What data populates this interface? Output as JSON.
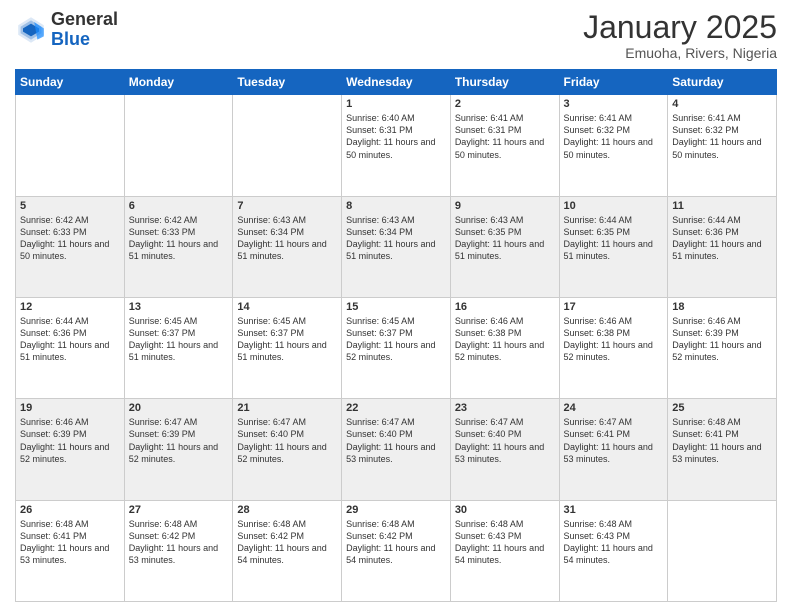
{
  "header": {
    "logo_line1": "General",
    "logo_line2": "Blue",
    "title": "January 2025",
    "subtitle": "Emuoha, Rivers, Nigeria"
  },
  "days_of_week": [
    "Sunday",
    "Monday",
    "Tuesday",
    "Wednesday",
    "Thursday",
    "Friday",
    "Saturday"
  ],
  "weeks": [
    [
      {
        "day": "",
        "sunrise": "",
        "sunset": "",
        "daylight": ""
      },
      {
        "day": "",
        "sunrise": "",
        "sunset": "",
        "daylight": ""
      },
      {
        "day": "",
        "sunrise": "",
        "sunset": "",
        "daylight": ""
      },
      {
        "day": "1",
        "sunrise": "Sunrise: 6:40 AM",
        "sunset": "Sunset: 6:31 PM",
        "daylight": "Daylight: 11 hours and 50 minutes."
      },
      {
        "day": "2",
        "sunrise": "Sunrise: 6:41 AM",
        "sunset": "Sunset: 6:31 PM",
        "daylight": "Daylight: 11 hours and 50 minutes."
      },
      {
        "day": "3",
        "sunrise": "Sunrise: 6:41 AM",
        "sunset": "Sunset: 6:32 PM",
        "daylight": "Daylight: 11 hours and 50 minutes."
      },
      {
        "day": "4",
        "sunrise": "Sunrise: 6:41 AM",
        "sunset": "Sunset: 6:32 PM",
        "daylight": "Daylight: 11 hours and 50 minutes."
      }
    ],
    [
      {
        "day": "5",
        "sunrise": "Sunrise: 6:42 AM",
        "sunset": "Sunset: 6:33 PM",
        "daylight": "Daylight: 11 hours and 50 minutes."
      },
      {
        "day": "6",
        "sunrise": "Sunrise: 6:42 AM",
        "sunset": "Sunset: 6:33 PM",
        "daylight": "Daylight: 11 hours and 51 minutes."
      },
      {
        "day": "7",
        "sunrise": "Sunrise: 6:43 AM",
        "sunset": "Sunset: 6:34 PM",
        "daylight": "Daylight: 11 hours and 51 minutes."
      },
      {
        "day": "8",
        "sunrise": "Sunrise: 6:43 AM",
        "sunset": "Sunset: 6:34 PM",
        "daylight": "Daylight: 11 hours and 51 minutes."
      },
      {
        "day": "9",
        "sunrise": "Sunrise: 6:43 AM",
        "sunset": "Sunset: 6:35 PM",
        "daylight": "Daylight: 11 hours and 51 minutes."
      },
      {
        "day": "10",
        "sunrise": "Sunrise: 6:44 AM",
        "sunset": "Sunset: 6:35 PM",
        "daylight": "Daylight: 11 hours and 51 minutes."
      },
      {
        "day": "11",
        "sunrise": "Sunrise: 6:44 AM",
        "sunset": "Sunset: 6:36 PM",
        "daylight": "Daylight: 11 hours and 51 minutes."
      }
    ],
    [
      {
        "day": "12",
        "sunrise": "Sunrise: 6:44 AM",
        "sunset": "Sunset: 6:36 PM",
        "daylight": "Daylight: 11 hours and 51 minutes."
      },
      {
        "day": "13",
        "sunrise": "Sunrise: 6:45 AM",
        "sunset": "Sunset: 6:37 PM",
        "daylight": "Daylight: 11 hours and 51 minutes."
      },
      {
        "day": "14",
        "sunrise": "Sunrise: 6:45 AM",
        "sunset": "Sunset: 6:37 PM",
        "daylight": "Daylight: 11 hours and 51 minutes."
      },
      {
        "day": "15",
        "sunrise": "Sunrise: 6:45 AM",
        "sunset": "Sunset: 6:37 PM",
        "daylight": "Daylight: 11 hours and 52 minutes."
      },
      {
        "day": "16",
        "sunrise": "Sunrise: 6:46 AM",
        "sunset": "Sunset: 6:38 PM",
        "daylight": "Daylight: 11 hours and 52 minutes."
      },
      {
        "day": "17",
        "sunrise": "Sunrise: 6:46 AM",
        "sunset": "Sunset: 6:38 PM",
        "daylight": "Daylight: 11 hours and 52 minutes."
      },
      {
        "day": "18",
        "sunrise": "Sunrise: 6:46 AM",
        "sunset": "Sunset: 6:39 PM",
        "daylight": "Daylight: 11 hours and 52 minutes."
      }
    ],
    [
      {
        "day": "19",
        "sunrise": "Sunrise: 6:46 AM",
        "sunset": "Sunset: 6:39 PM",
        "daylight": "Daylight: 11 hours and 52 minutes."
      },
      {
        "day": "20",
        "sunrise": "Sunrise: 6:47 AM",
        "sunset": "Sunset: 6:39 PM",
        "daylight": "Daylight: 11 hours and 52 minutes."
      },
      {
        "day": "21",
        "sunrise": "Sunrise: 6:47 AM",
        "sunset": "Sunset: 6:40 PM",
        "daylight": "Daylight: 11 hours and 52 minutes."
      },
      {
        "day": "22",
        "sunrise": "Sunrise: 6:47 AM",
        "sunset": "Sunset: 6:40 PM",
        "daylight": "Daylight: 11 hours and 53 minutes."
      },
      {
        "day": "23",
        "sunrise": "Sunrise: 6:47 AM",
        "sunset": "Sunset: 6:40 PM",
        "daylight": "Daylight: 11 hours and 53 minutes."
      },
      {
        "day": "24",
        "sunrise": "Sunrise: 6:47 AM",
        "sunset": "Sunset: 6:41 PM",
        "daylight": "Daylight: 11 hours and 53 minutes."
      },
      {
        "day": "25",
        "sunrise": "Sunrise: 6:48 AM",
        "sunset": "Sunset: 6:41 PM",
        "daylight": "Daylight: 11 hours and 53 minutes."
      }
    ],
    [
      {
        "day": "26",
        "sunrise": "Sunrise: 6:48 AM",
        "sunset": "Sunset: 6:41 PM",
        "daylight": "Daylight: 11 hours and 53 minutes."
      },
      {
        "day": "27",
        "sunrise": "Sunrise: 6:48 AM",
        "sunset": "Sunset: 6:42 PM",
        "daylight": "Daylight: 11 hours and 53 minutes."
      },
      {
        "day": "28",
        "sunrise": "Sunrise: 6:48 AM",
        "sunset": "Sunset: 6:42 PM",
        "daylight": "Daylight: 11 hours and 54 minutes."
      },
      {
        "day": "29",
        "sunrise": "Sunrise: 6:48 AM",
        "sunset": "Sunset: 6:42 PM",
        "daylight": "Daylight: 11 hours and 54 minutes."
      },
      {
        "day": "30",
        "sunrise": "Sunrise: 6:48 AM",
        "sunset": "Sunset: 6:43 PM",
        "daylight": "Daylight: 11 hours and 54 minutes."
      },
      {
        "day": "31",
        "sunrise": "Sunrise: 6:48 AM",
        "sunset": "Sunset: 6:43 PM",
        "daylight": "Daylight: 11 hours and 54 minutes."
      },
      {
        "day": "",
        "sunrise": "",
        "sunset": "",
        "daylight": ""
      }
    ]
  ]
}
